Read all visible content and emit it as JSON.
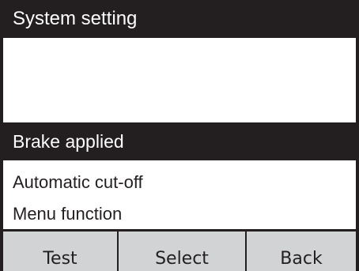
{
  "screen": {
    "title": "System setting"
  },
  "menu": {
    "items": [
      {
        "label": "Brake applied",
        "selected": true
      },
      {
        "label": "Automatic cut-off",
        "selected": false
      },
      {
        "label": "Menu function",
        "selected": false
      }
    ]
  },
  "softkeys": [
    {
      "label": "Test"
    },
    {
      "label": "Select"
    },
    {
      "label": "Back"
    }
  ],
  "colors": {
    "dark": "#231f20",
    "key_background": "#d1d3d4",
    "background": "#ffffff"
  }
}
